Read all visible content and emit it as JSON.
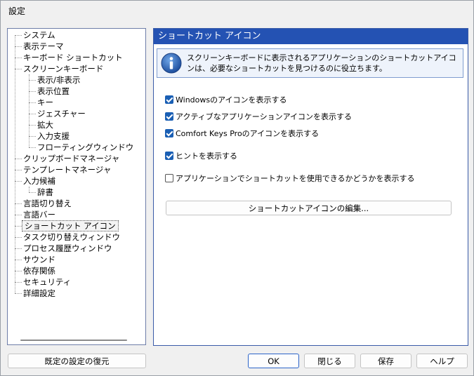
{
  "window": {
    "title": "設定"
  },
  "tree": {
    "items": [
      {
        "label": "システム",
        "level": 0
      },
      {
        "label": "表示テーマ",
        "level": 0
      },
      {
        "label": "キーボード ショートカット",
        "level": 0
      },
      {
        "label": "スクリーンキーボード",
        "level": 0
      },
      {
        "label": "表示/非表示",
        "level": 1
      },
      {
        "label": "表示位置",
        "level": 1
      },
      {
        "label": "キー",
        "level": 1
      },
      {
        "label": "ジェスチャー",
        "level": 1
      },
      {
        "label": "拡大",
        "level": 1
      },
      {
        "label": "入力支援",
        "level": 1
      },
      {
        "label": "フローティングウィンドウ",
        "level": 1
      },
      {
        "label": "クリップボードマネージャ",
        "level": 0
      },
      {
        "label": "テンプレートマネージャ",
        "level": 0
      },
      {
        "label": "入力候補",
        "level": 0
      },
      {
        "label": "辞書",
        "level": 1
      },
      {
        "label": "言語切り替え",
        "level": 0
      },
      {
        "label": "言語バー",
        "level": 0
      },
      {
        "label": "ショートカット アイコン",
        "level": 0,
        "selected": true
      },
      {
        "label": "タスク切り替えウィンドウ",
        "level": 0
      },
      {
        "label": "プロセス履歴ウィンドウ",
        "level": 0
      },
      {
        "label": "サウンド",
        "level": 0
      },
      {
        "label": "依存関係",
        "level": 0
      },
      {
        "label": "セキュリティ",
        "level": 0
      },
      {
        "label": "詳細設定",
        "level": 0
      }
    ]
  },
  "panel": {
    "title": "ショートカット アイコン",
    "info": "スクリーンキーボードに表示されるアプリケーションのショートカットアイコンは、必要なショートカットを見つけるのに役立ちます。",
    "options": [
      {
        "label": "Windowsのアイコンを表示する",
        "checked": true
      },
      {
        "label": "アクティブなアプリケーションアイコンを表示する",
        "checked": true
      },
      {
        "label": "Comfort Keys Proのアイコンを表示する",
        "checked": true
      },
      {
        "label": "ヒントを表示する",
        "checked": true
      },
      {
        "label": "アプリケーションでショートカットを使用できるかどうかを表示する",
        "checked": false
      }
    ],
    "edit_button": "ショートカットアイコンの編集..."
  },
  "footer": {
    "restore": "既定の設定の復元",
    "ok": "OK",
    "close": "閉じる",
    "save": "保存",
    "help": "ヘルプ"
  },
  "colors": {
    "header": "#2452b3",
    "accent": "#1a5fb4"
  }
}
